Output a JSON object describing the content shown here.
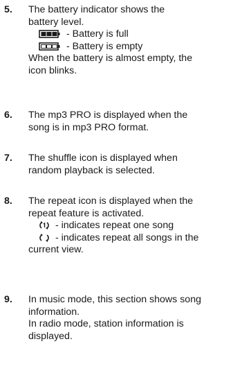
{
  "items": [
    {
      "number": "5.",
      "line1": "The battery indicator shows the",
      "line2": "battery level.",
      "full": "- Battery is full",
      "empty": "- Battery is empty",
      "line3": "When the battery is almost empty, the",
      "line4": "icon blinks.",
      "icons": {
        "full": "battery-full-icon",
        "empty": "battery-empty-icon"
      }
    },
    {
      "number": "6.",
      "line1": "The mp3 PRO is displayed when the",
      "line2": "song is in mp3 PRO format."
    },
    {
      "number": "7.",
      "line1": "The shuffle icon is displayed when",
      "line2": "random playback is selected."
    },
    {
      "number": "8.",
      "line1": "The repeat icon is displayed when the",
      "line2": "repeat feature is activated.",
      "one": "- indicates repeat one song",
      "all": "- indicates repeat all songs in the",
      "line3": "current view.",
      "icons": {
        "one": "repeat-one-icon",
        "all": "repeat-all-icon"
      }
    },
    {
      "number": "9.",
      "line1": "In music mode, this section shows song",
      "line2": "information.",
      "line3": "In radio mode, station information is",
      "line4": "displayed."
    }
  ],
  "colors": {
    "text": "#1a1a1a"
  }
}
